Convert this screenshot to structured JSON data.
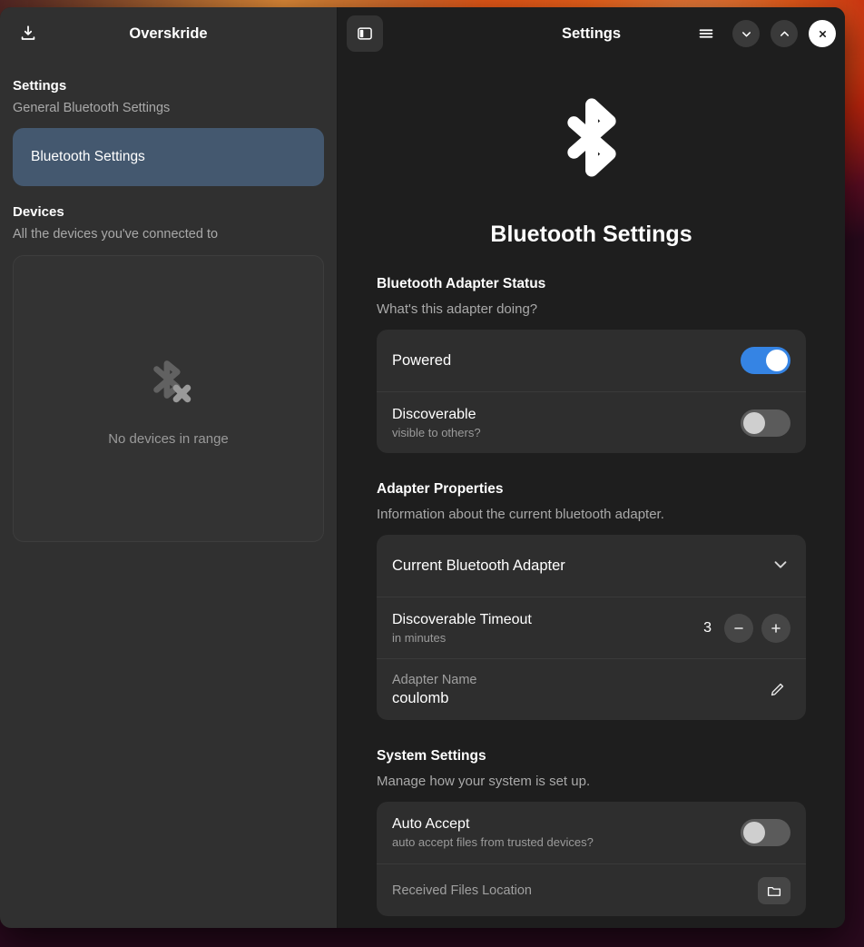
{
  "app": {
    "sidebar_title": "Overskride",
    "content_title": "Settings"
  },
  "sidebar": {
    "download_icon": "download-icon",
    "settings_group": {
      "title": "Settings",
      "subtitle": "General Bluetooth Settings",
      "items": [
        {
          "label": "Bluetooth Settings",
          "selected": true
        }
      ]
    },
    "devices_group": {
      "title": "Devices",
      "subtitle": "All the devices you've connected to",
      "empty_icon": "bluetooth-disabled-icon",
      "empty_text": "No devices in range"
    }
  },
  "header": {
    "panel_toggle_icon": "sidebar-toggle-icon",
    "menu_icon": "hamburger-menu-icon",
    "down_icon": "chevron-down-icon",
    "up_icon": "chevron-up-icon",
    "close_icon": "close-icon"
  },
  "hero": {
    "icon": "bluetooth-icon",
    "title": "Bluetooth Settings"
  },
  "sections": [
    {
      "title": "Bluetooth Adapter Status",
      "subtitle": "What's this adapter doing?",
      "rows": [
        {
          "title": "Powered",
          "subtitle": "",
          "control": "toggle",
          "state": "on"
        },
        {
          "title": "Discoverable",
          "subtitle": "visible to others?",
          "control": "toggle",
          "state": "off"
        }
      ]
    },
    {
      "title": "Adapter Properties",
      "subtitle": "Information about the current bluetooth adapter.",
      "rows": [
        {
          "title": "Current Bluetooth Adapter",
          "control": "expander",
          "icon": "chevron-down-icon"
        },
        {
          "title": "Discoverable Timeout",
          "subtitle": "in minutes",
          "control": "stepper",
          "value": "3",
          "minus_label": "−",
          "plus_label": "+"
        },
        {
          "title": "Adapter Name",
          "value": "coulomb",
          "control": "edit",
          "icon": "pencil-icon"
        }
      ]
    },
    {
      "title": "System Settings",
      "subtitle": "Manage how your system is set up.",
      "rows": [
        {
          "title": "Auto Accept",
          "subtitle": "auto accept files from trusted devices?",
          "control": "toggle",
          "state": "off"
        },
        {
          "title": "Received Files Location",
          "control": "folder",
          "icon": "folder-icon"
        }
      ]
    }
  ],
  "colors": {
    "accent": "#3584e4",
    "sidebar_selected": "#44586f",
    "card": "#2e2e2e",
    "window_bg": "#1e1e1e",
    "sidebar_bg": "#303030"
  }
}
